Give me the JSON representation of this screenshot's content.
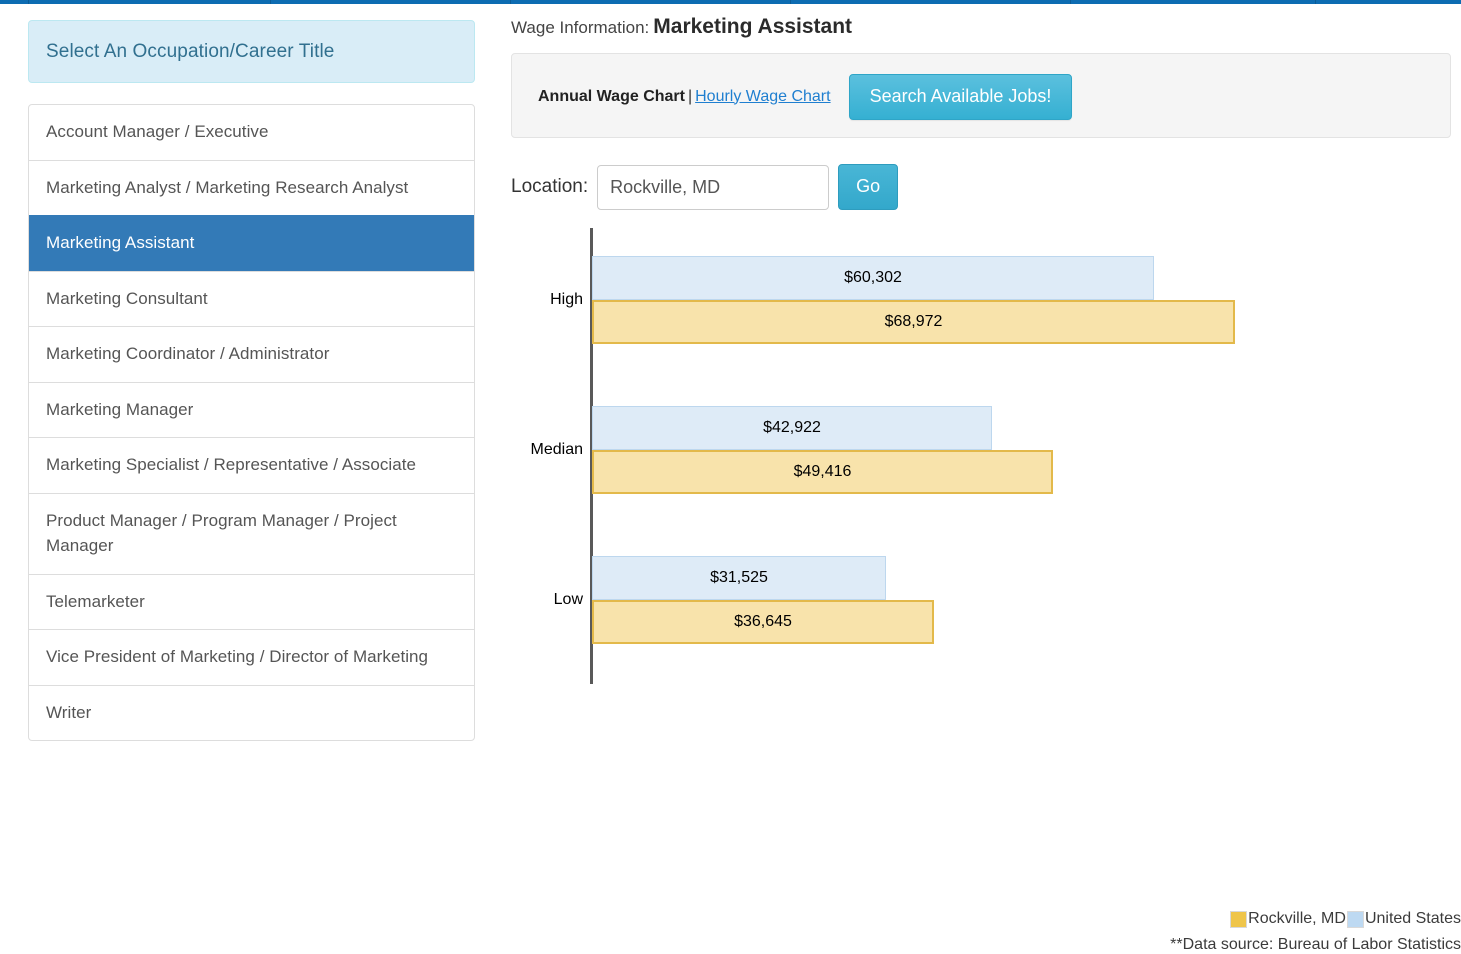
{
  "topbar": {
    "color": "#0d6cb2",
    "divider_positions": [
      28,
      270,
      510,
      790,
      1070,
      1315
    ]
  },
  "sidebar": {
    "header": "Select An Occupation/Career Title",
    "items": [
      {
        "label": "Account Manager / Executive",
        "selected": false
      },
      {
        "label": "Marketing Analyst / Marketing Research Analyst",
        "selected": false
      },
      {
        "label": "Marketing Assistant",
        "selected": true
      },
      {
        "label": "Marketing Consultant",
        "selected": false
      },
      {
        "label": "Marketing Coordinator / Administrator",
        "selected": false
      },
      {
        "label": "Marketing Manager",
        "selected": false
      },
      {
        "label": "Marketing Specialist / Representative / Associate",
        "selected": false
      },
      {
        "label": "Product Manager / Program Manager / Project Manager",
        "selected": false
      },
      {
        "label": "Telemarketer",
        "selected": false
      },
      {
        "label": "Vice President of Marketing / Director of Marketing",
        "selected": false
      },
      {
        "label": "Writer",
        "selected": false
      }
    ]
  },
  "header": {
    "prefix": "Wage Information:",
    "occupation": "Marketing Assistant"
  },
  "toolbar": {
    "annual_label": "Annual Wage Chart",
    "separator": "|",
    "hourly_link": "Hourly Wage Chart",
    "search_jobs_button": "Search Available Jobs!"
  },
  "location": {
    "label": "Location:",
    "value": "Rockville, MD",
    "placeholder": "City, State or Zip",
    "go_button": "Go"
  },
  "chart_data": {
    "type": "bar",
    "orientation": "horizontal",
    "title": "",
    "xlabel": "",
    "ylabel": "",
    "categories": [
      "High",
      "Median",
      "Low"
    ],
    "series": [
      {
        "name": "United States",
        "color": "#deebf7",
        "border_color": "#bdd7ee",
        "values": [
          60302,
          42922,
          31525
        ],
        "labels": [
          "$60,302",
          "$42,922",
          "$31,525"
        ]
      },
      {
        "name": "Rockville, MD",
        "color": "#f8e3ab",
        "border_color": "#e3b94a",
        "values": [
          68972,
          49416,
          36645
        ],
        "labels": [
          "$68,972",
          "$49,416",
          "$36,645"
        ]
      }
    ],
    "xlim": [
      0,
      68972
    ],
    "grid": false,
    "legend_position": "bottom-right",
    "legend": [
      "Rockville, MD",
      "United States"
    ],
    "footnote": "**Data source: Bureau of Labor Statistics"
  }
}
